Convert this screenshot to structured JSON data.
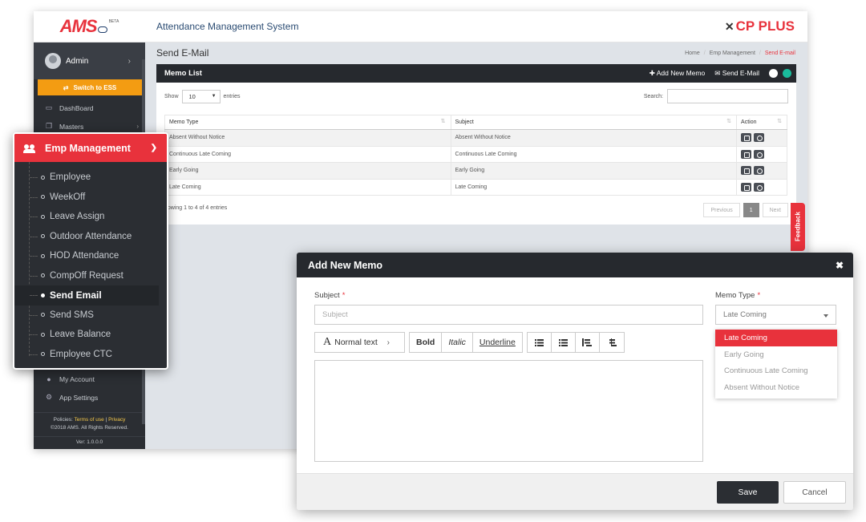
{
  "app": {
    "logo_text": "AMS",
    "logo_badge": "BETA",
    "title": "Attendance Management System",
    "brand": "CP PLUS",
    "brand_color": "#e8323c"
  },
  "sidebar": {
    "user": "Admin",
    "switch_label": "Switch to ESS",
    "items": [
      {
        "label": "DashBoard",
        "icon": "laptop-icon"
      },
      {
        "label": "Masters",
        "icon": "copy-icon"
      }
    ],
    "lower_items": [
      {
        "label": "My Account",
        "icon": "user-icon"
      },
      {
        "label": "App Settings",
        "icon": "gears-icon"
      }
    ],
    "footer": {
      "policies": "Policies:",
      "terms": "Terms of use",
      "sep": "|",
      "privacy": "Privacy",
      "copyright": "©2018 AMS. All Rights Reserved.",
      "version": "Ver: 1.0.0.0"
    }
  },
  "page": {
    "title": "Send E-Mail",
    "breadcrumb": [
      "Home",
      "Emp Management",
      "Send E-mail"
    ]
  },
  "memo_panel": {
    "title": "Memo List",
    "add_label": "Add New Memo",
    "send_label": "Send E-Mail",
    "show_label": "Show",
    "entries_value": "10",
    "entries_label": "entries",
    "search_label": "Search:",
    "columns": [
      "Memo Type",
      "Subject",
      "Action"
    ],
    "rows": [
      {
        "type": "Absent Without Notice",
        "subject": "Absent Without Notice"
      },
      {
        "type": "Continuous Late Coming",
        "subject": "Continuous Late Coming"
      },
      {
        "type": "Early Going",
        "subject": "Early Going"
      },
      {
        "type": "Late Coming",
        "subject": "Late Coming"
      }
    ],
    "info": "howing 1 to 4 of 4 entries",
    "pager": {
      "prev": "Previous",
      "current": "1",
      "next": "Next"
    }
  },
  "feedback_label": "Feedback",
  "emp_menu": {
    "title": "Emp Management",
    "items": [
      {
        "label": "Employee"
      },
      {
        "label": "WeekOff"
      },
      {
        "label": "Leave Assign"
      },
      {
        "label": "Outdoor Attendance"
      },
      {
        "label": "HOD Attendance"
      },
      {
        "label": "CompOff Request"
      },
      {
        "label": "Send Email",
        "active": true
      },
      {
        "label": "Send SMS"
      },
      {
        "label": "Leave Balance"
      },
      {
        "label": "Employee CTC"
      }
    ]
  },
  "modal": {
    "title": "Add New Memo",
    "close": "✖",
    "subject_label": "Subject",
    "required_mark": "*",
    "subject_placeholder": "Subject",
    "memo_type_label": "Memo Type",
    "memo_type_value": "Late Coming",
    "memo_type_options": [
      "Late Coming",
      "Early Going",
      "Continuous Late Coming",
      "Absent Without Notice"
    ],
    "toolbar": {
      "normal_icon": "A",
      "normal_text": "Normal text",
      "bold": "Bold",
      "italic": "Italic",
      "underline": "Underline"
    },
    "save_label": "Save",
    "cancel_label": "Cancel"
  }
}
